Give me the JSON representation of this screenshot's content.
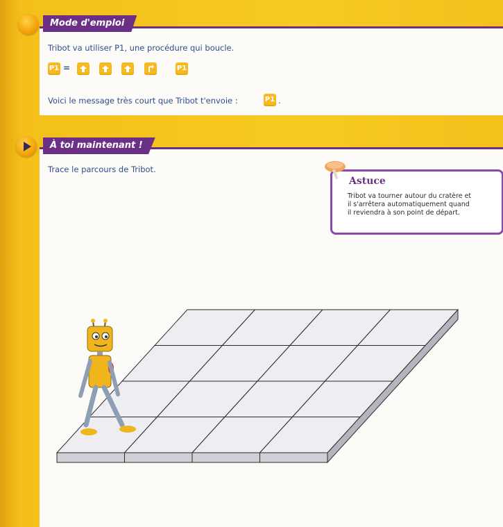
{
  "section1": {
    "title": "Mode d'emploi",
    "line1": "Tribot va utiliser P1, une procédure qui boucle.",
    "definition": {
      "name": "P1",
      "equals": "=",
      "steps": [
        {
          "type": "arrow-up",
          "icon": "arrow-up-icon"
        },
        {
          "type": "arrow-up",
          "icon": "arrow-up-icon"
        },
        {
          "type": "arrow-up",
          "icon": "arrow-up-icon"
        },
        {
          "type": "turn",
          "icon": "turn-arrow-icon"
        },
        {
          "type": "call",
          "label": "P1"
        }
      ]
    },
    "line2": "Voici le message très court que Tribot t'envoie :",
    "message_token": "P1",
    "line2_end": "."
  },
  "section2": {
    "title": "À toi maintenant !",
    "instruction": "Trace le parcours de Tribot."
  },
  "astuce": {
    "title": "Astuce",
    "lines": [
      "Tribot va tourner autour du cratère et",
      "il s'arrêtera automatiquement quand",
      "il reviendra à son point de départ."
    ]
  },
  "grid": {
    "rows": 4,
    "cols": 4
  },
  "colors": {
    "accent_purple": "#6b2f86",
    "token_yellow": "#f7b91f",
    "page_yellow": "#f7c61d",
    "text_blue": "#2d4e8a"
  }
}
